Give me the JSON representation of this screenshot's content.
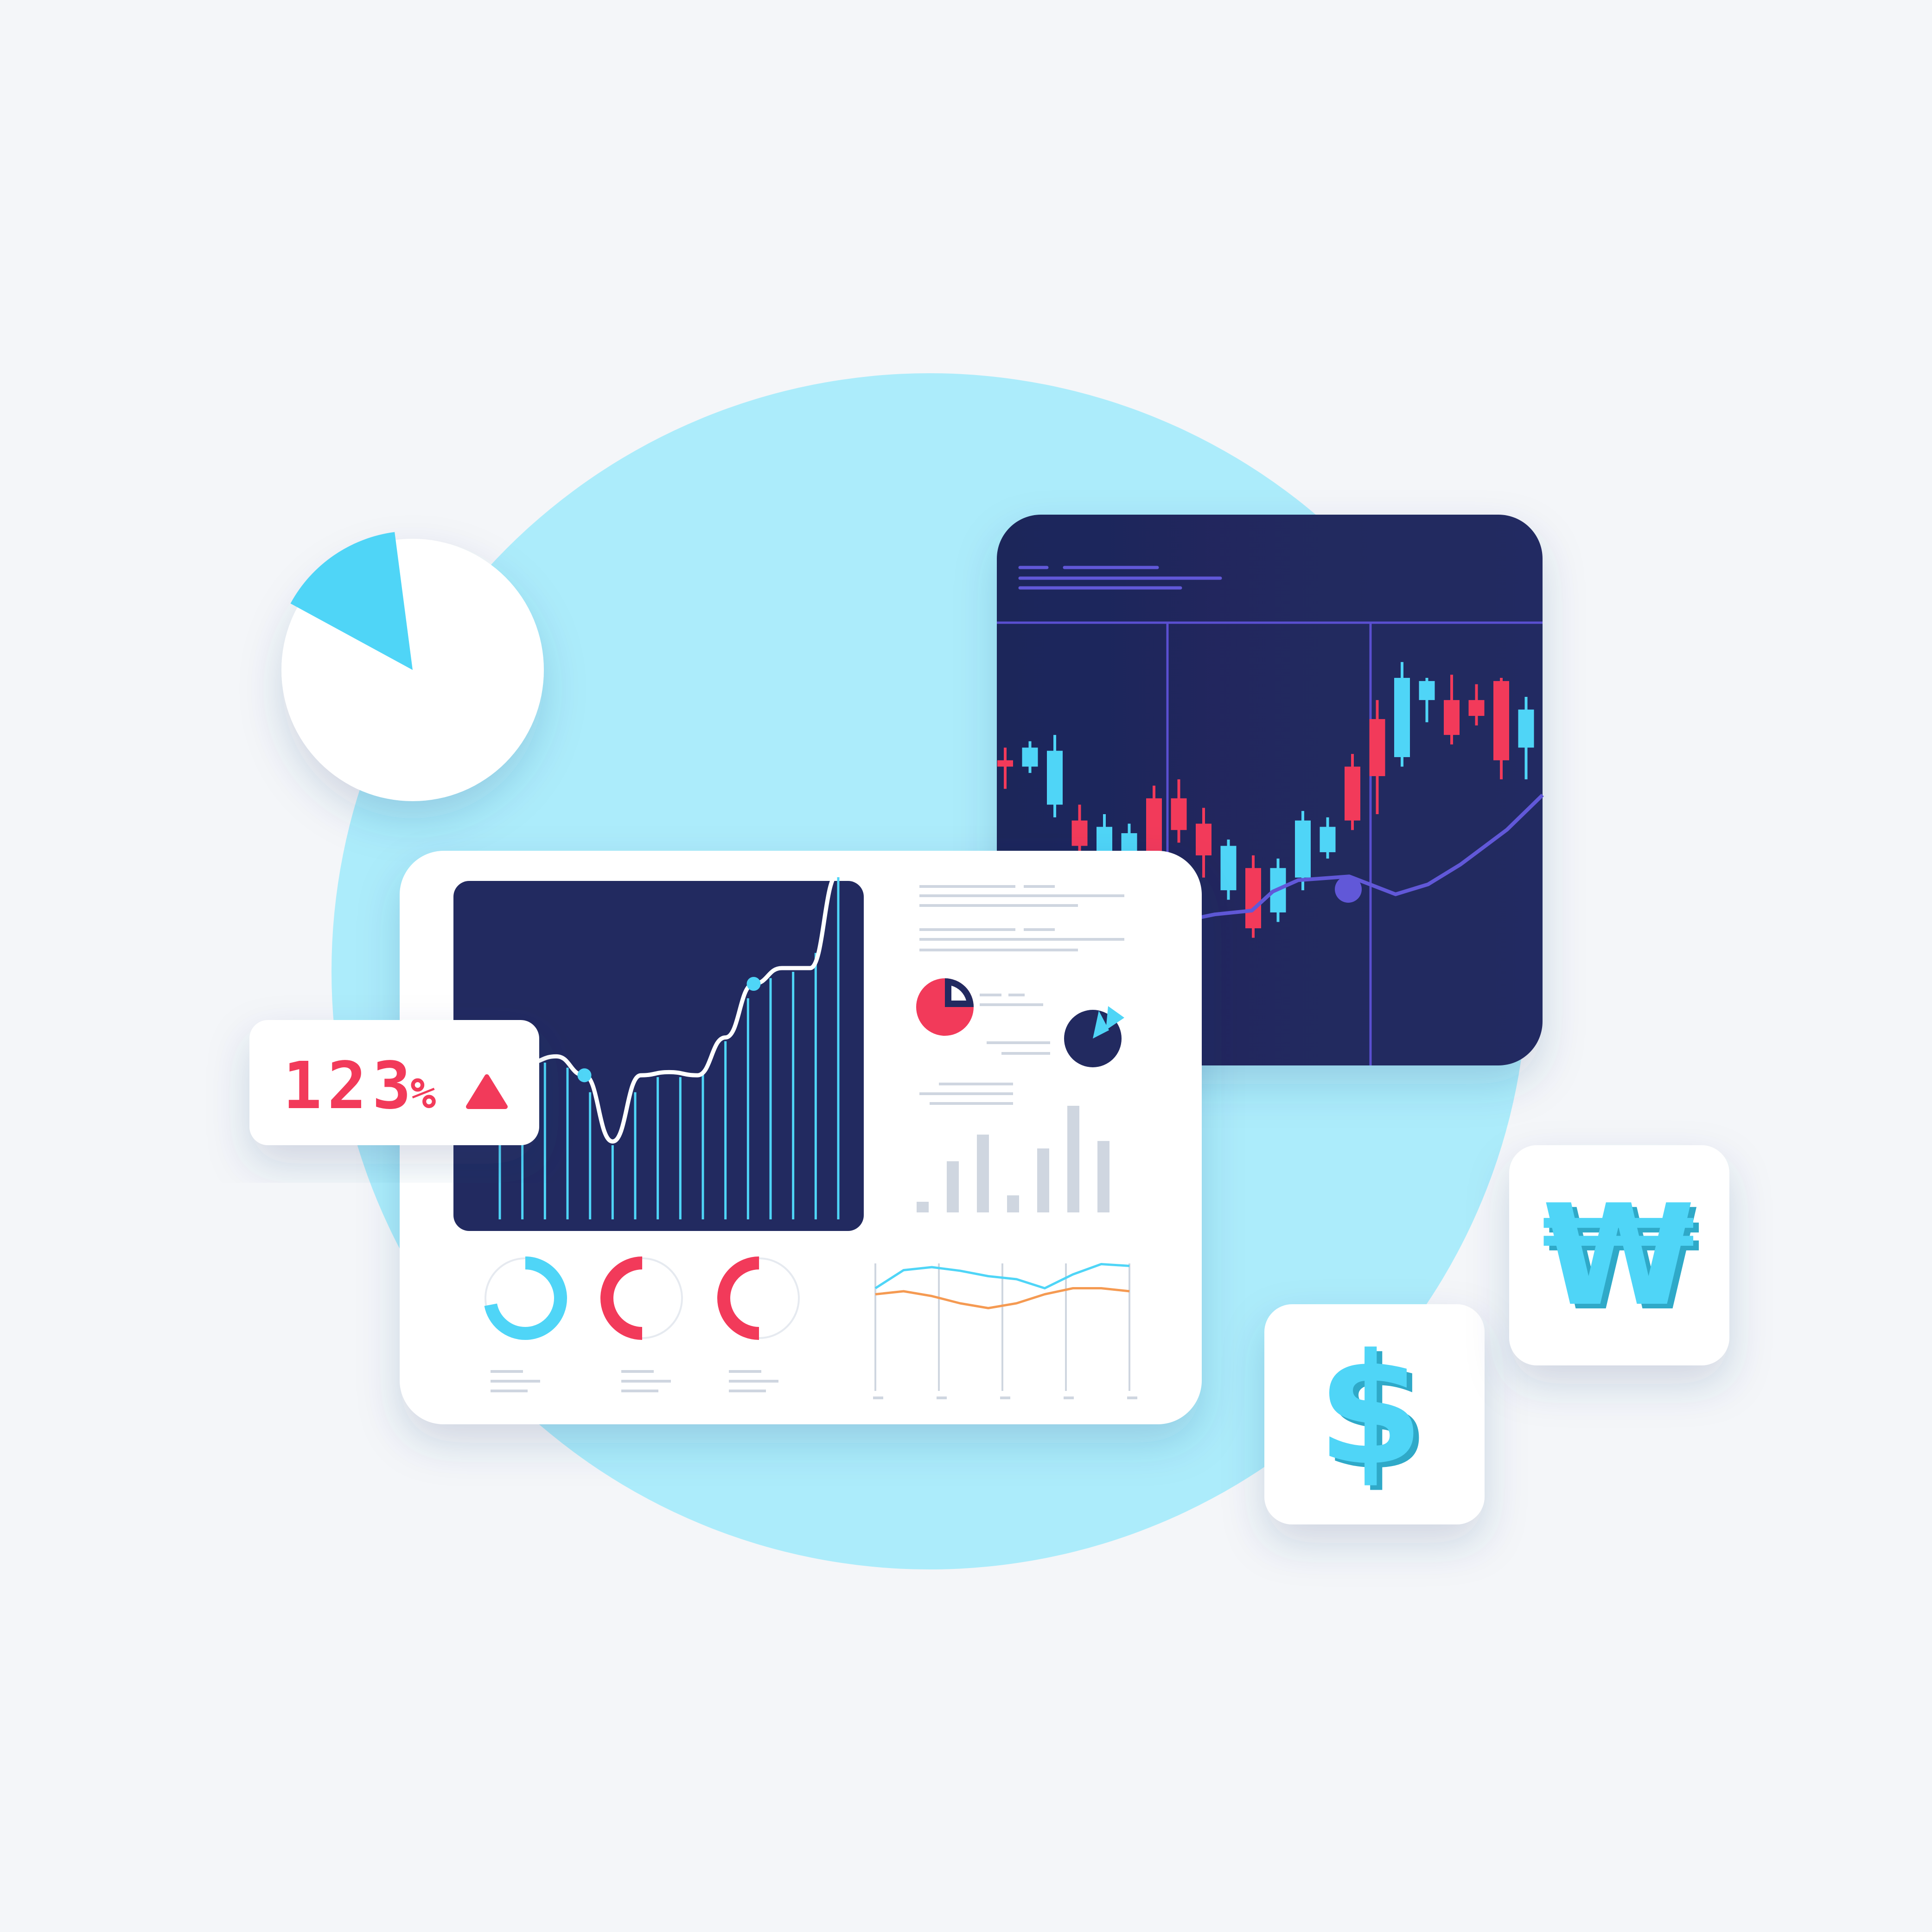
{
  "colors": {
    "background": "#f4f6f9",
    "circle": "#acecfb",
    "navy": "#222a60",
    "cyan": "#4fd5f7",
    "red": "#f23a5a",
    "orange": "#f59a52",
    "purple": "#6158d8",
    "grey_bars": "#cfd6e0",
    "card": "#ffffff"
  },
  "percent_badge": {
    "value": "123",
    "unit": "%",
    "trend_icon": "up-triangle-icon"
  },
  "currency_tiles": [
    {
      "name": "dollar",
      "glyph": "$"
    },
    {
      "name": "won",
      "glyph": "₩"
    }
  ],
  "pie_badge": {
    "slice_fraction": 0.15,
    "icon": "pie-chart-icon"
  },
  "area_chart": {
    "line_values": [
      0.62,
      0.7,
      0.72,
      0.66,
      0.45,
      0.66,
      0.67,
      0.66,
      0.78,
      0.95,
      1.0,
      1.0,
      1.3
    ],
    "highlight_indices": [
      3,
      9
    ]
  },
  "candlestick_chart": {
    "candles": [
      {
        "o": 52,
        "c": 50,
        "h": 56,
        "l": 43,
        "up": false
      },
      {
        "o": 50,
        "c": 56,
        "h": 58,
        "l": 48,
        "up": true
      },
      {
        "o": 38,
        "c": 55,
        "h": 60,
        "l": 34,
        "up": true
      },
      {
        "o": 33,
        "c": 25,
        "h": 38,
        "l": 18,
        "up": false
      },
      {
        "o": 22,
        "c": 31,
        "h": 35,
        "l": 14,
        "up": true
      },
      {
        "o": 22,
        "c": 29,
        "h": 32,
        "l": 17,
        "up": true
      },
      {
        "o": 40,
        "c": 17,
        "h": 44,
        "l": 13,
        "up": false
      },
      {
        "o": 40,
        "c": 30,
        "h": 46,
        "l": 26,
        "up": false
      },
      {
        "o": 32,
        "c": 22,
        "h": 37,
        "l": 15,
        "up": false
      },
      {
        "o": 11,
        "c": 25,
        "h": 27,
        "l": 8,
        "up": true
      },
      {
        "o": 18,
        "c": -1,
        "h": 22,
        "l": -4,
        "up": false
      },
      {
        "o": 4,
        "c": 18,
        "h": 21,
        "l": 1,
        "up": true
      },
      {
        "o": 15,
        "c": 33,
        "h": 36,
        "l": 11,
        "up": true
      },
      {
        "o": 23,
        "c": 31,
        "h": 34,
        "l": 21,
        "up": true
      },
      {
        "o": 50,
        "c": 33,
        "h": 54,
        "l": 30,
        "up": false
      },
      {
        "o": 65,
        "c": 47,
        "h": 71,
        "l": 35,
        "up": false
      },
      {
        "o": 53,
        "c": 78,
        "h": 83,
        "l": 50,
        "up": true
      },
      {
        "o": 71,
        "c": 77,
        "h": 78,
        "l": 64,
        "up": true
      },
      {
        "o": 71,
        "c": 60,
        "h": 79,
        "l": 57,
        "up": false
      },
      {
        "o": 71,
        "c": 66,
        "h": 76,
        "l": 63,
        "up": false
      },
      {
        "o": 77,
        "c": 52,
        "h": 78,
        "l": 46,
        "up": false
      },
      {
        "o": 56,
        "c": 68,
        "h": 72,
        "l": 46,
        "up": true
      }
    ],
    "moving_average": [
      2,
      4,
      5,
      10,
      13,
      14,
      16,
      18,
      22,
      29,
      36
    ]
  },
  "mini_bars": {
    "values": [
      0.1,
      0.48,
      0.73,
      0.16,
      0.6,
      1.0,
      0.67
    ]
  },
  "donuts": [
    {
      "color": "cyan",
      "fraction": 0.72
    },
    {
      "color": "red",
      "fraction": 0.5
    },
    {
      "color": "red",
      "fraction": 0.5
    }
  ],
  "mini_lines": {
    "cyan": [
      0.55,
      0.85,
      0.9,
      0.84,
      0.75,
      0.7,
      0.55,
      0.78,
      0.95,
      0.92
    ],
    "orange": [
      0.45,
      0.5,
      0.42,
      0.3,
      0.22,
      0.3,
      0.45,
      0.55,
      0.55,
      0.5
    ]
  }
}
